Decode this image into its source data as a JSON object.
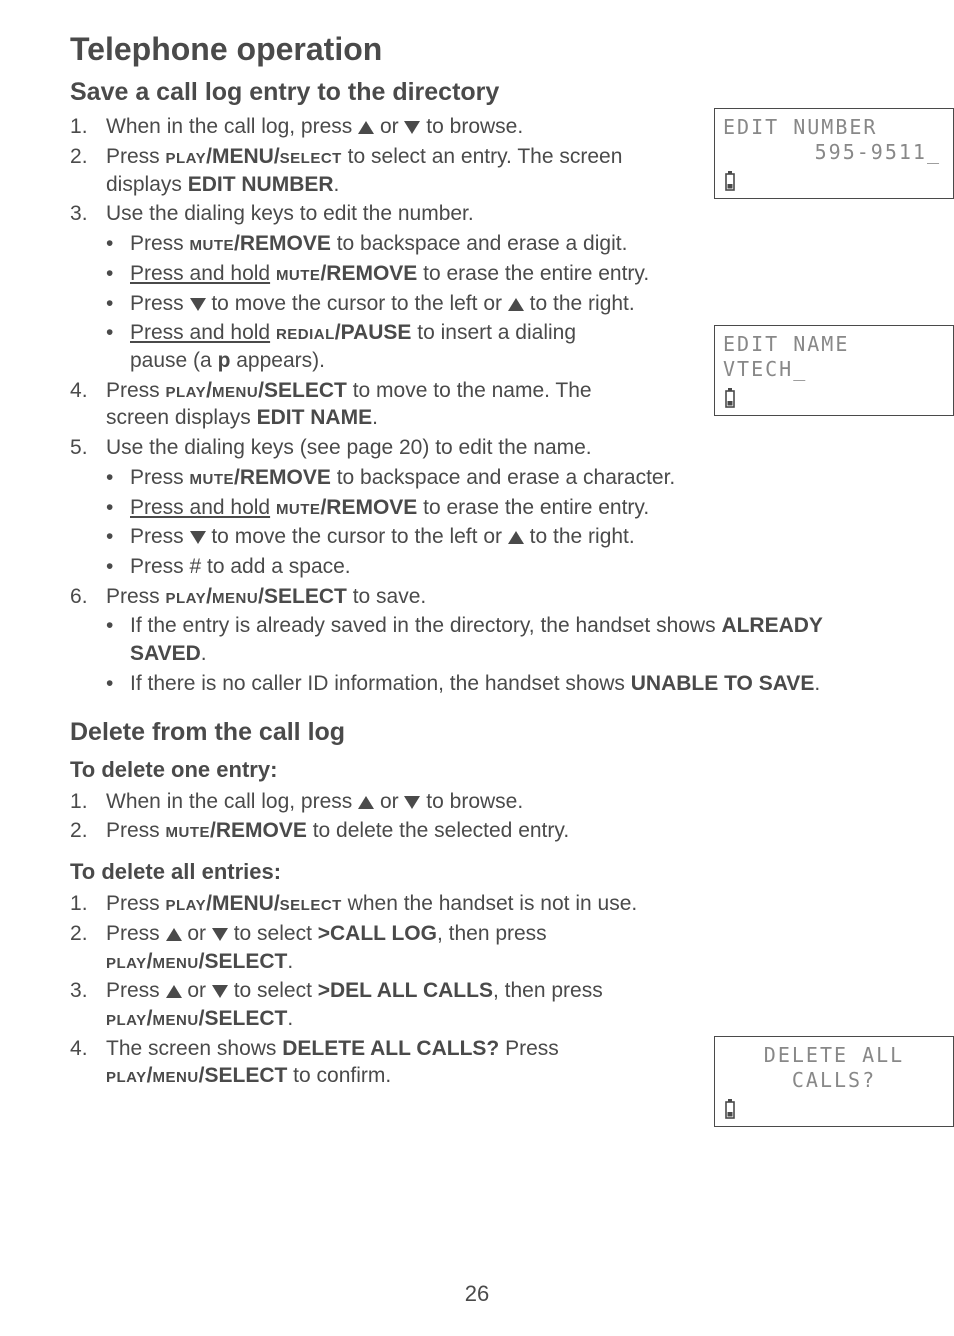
{
  "title": "Telephone operation",
  "section1": {
    "heading": "Save a call log entry to the directory",
    "steps": {
      "s1a": "When in the call log, press ",
      "s1b": " or ",
      "s1c": " to browse.",
      "s2a": "Press ",
      "s2b_sc": "play",
      "s2c": "/MENU/",
      "s2d_sc": "select",
      "s2e": " to select an entry. The screen displays ",
      "s2f_bold": "EDIT NUMBER",
      "s2g": ".",
      "s3": "Use the dialing keys to edit the number.",
      "s3_sub": {
        "a1": "Press ",
        "a2_sc": "mute",
        "a3": "/REMOVE",
        "a4": " to backspace and erase a digit.",
        "b1_u": "Press and hold",
        "b2": " ",
        "b3_sc": "mute",
        "b4": "/REMOVE",
        "b5": " to erase the entire entry.",
        "c1": "Press ",
        "c2": " to move the cursor to the left or ",
        "c3": " to the right.",
        "d1_u": "Press and hold",
        "d2": " ",
        "d3_sc": "redial",
        "d4": "/PAUSE",
        "d5": " to insert a dialing pause (a ",
        "d6_bold": "p",
        "d7": " appears)."
      },
      "s4a": "Press ",
      "s4b_sc": "play",
      "s4c": "/",
      "s4d_sc": "menu",
      "s4e": "/SELECT",
      "s4f": " to move to the name. The screen displays ",
      "s4g_bold": "EDIT NAME",
      "s4h": ".",
      "s5": "Use the dialing keys (see page 20) to edit the name.",
      "s5_sub": {
        "a1": "Press ",
        "a2_sc": "mute",
        "a3": "/REMOVE",
        "a4": " to backspace and erase a character.",
        "b1_u": "Press and hold",
        "b2": " ",
        "b3_sc": "mute",
        "b4": "/REMOVE",
        "b5": " to erase the entire entry.",
        "c1": "Press ",
        "c2": " to move the cursor to the left or ",
        "c3": " to the right.",
        "d": "Press # to add a space."
      },
      "s6a": "Press ",
      "s6b_sc": "play",
      "s6c": "/",
      "s6d_sc": "menu",
      "s6e": "/SELECT",
      "s6f": " to save.",
      "s6_sub": {
        "a1": "If the entry is already saved in the directory, the handset shows ",
        "a2_bold": "ALREADY SAVED",
        "a3": ".",
        "b1": "If there is no caller ID information, the handset shows ",
        "b2_bold": "UNABLE TO SAVE",
        "b3": "."
      }
    }
  },
  "section2": {
    "heading": "Delete from the call log",
    "sub1": "To delete one entry:",
    "steps1": {
      "s1a": "When in the call log, press ",
      "s1b": " or ",
      "s1c": " to browse.",
      "s2a": "Press ",
      "s2b_sc": "mute",
      "s2c": "/REMOVE",
      "s2d": " to delete the selected entry."
    },
    "sub2": "To delete all entries:",
    "steps2": {
      "s1a": "Press ",
      "s1b_sc": "play",
      "s1c": "/MENU/",
      "s1d_sc": "select",
      "s1e": " when the handset is not in use.",
      "s2a": "Press ",
      "s2b": " or ",
      "s2c": " to select ",
      "s2d_bold": ">CALL LOG",
      "s2e": ", then press ",
      "s2f_sc": "play",
      "s2g": "/",
      "s2h_sc": "menu",
      "s2i": "/SELECT",
      "s2j": ".",
      "s3a": "Press ",
      "s3b": " or ",
      "s3c": " to select ",
      "s3d_bold": ">DEL ALL CALLS",
      "s3e": ", then press ",
      "s3f_sc": "play",
      "s3g": "/",
      "s3h_sc": "menu",
      "s3i": "/SELECT",
      "s3j": ".",
      "s4a": "The screen shows ",
      "s4b_bold": "DELETE ALL CALLS?",
      "s4c": " Press ",
      "s4d_sc": "play",
      "s4e": "/",
      "s4f_sc": "menu",
      "s4g": "/SELECT",
      "s4h": " to confirm."
    }
  },
  "lcd1": {
    "line1": "EDIT NUMBER",
    "line2": "595-9511_"
  },
  "lcd2": {
    "line1": "EDIT NAME",
    "line2": "VTECH_"
  },
  "lcd3": {
    "line1": "DELETE ALL",
    "line2": "CALLS?"
  },
  "page_number": "26"
}
